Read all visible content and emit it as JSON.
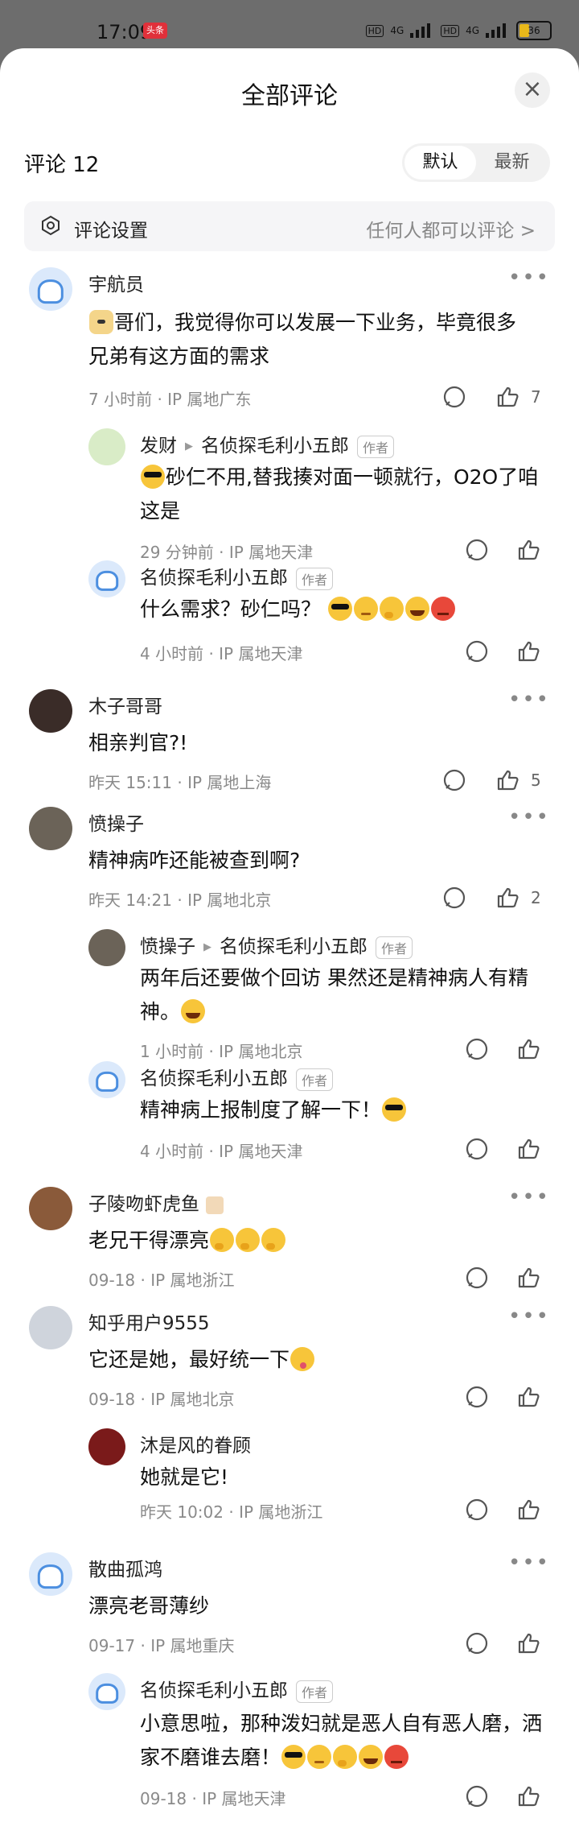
{
  "status_bar": {
    "time": "17:09",
    "app_badge": "头条",
    "network": "4G",
    "battery": "36",
    "battery_level": 0.36
  },
  "sheet": {
    "title": "全部评论",
    "close_icon": "close-icon",
    "count_label": "评论 12",
    "sort": {
      "default": "默认",
      "latest": "最新",
      "selected": "默认"
    },
    "settings": {
      "label": "评论设置",
      "value": "任何人都可以评论 >",
      "icon": "settings-icon"
    }
  },
  "comments": [
    {
      "name": "宇航员",
      "text_line1": "哥们，我觉得你可以发展一下业务，毕竟很多",
      "text_line2": "兄弟有这方面的需求",
      "meta": "7 小时前 · IP 属地广东",
      "likes": "7",
      "replies": [
        {
          "name": "发财",
          "target": "名侦探毛利小五郎",
          "tag": "作者",
          "text_line1": "砂仁不用,替我揍对面一顿就行，O2O了咱",
          "text_line2": "这是",
          "meta": "29 分钟前 · IP 属地天津"
        },
        {
          "name": "名侦探毛利小五郎",
          "tag": "作者",
          "text_line1": "什么需求？砂仁吗？",
          "meta": "4 小时前 · IP 属地天津"
        }
      ]
    },
    {
      "name": "木子哥哥",
      "text_line1": "相亲判官?!",
      "meta": "昨天 15:11 · IP 属地上海",
      "likes": "5"
    },
    {
      "name": "愤操子",
      "text_line1": "精神病咋还能被查到啊?",
      "meta": "昨天 14:21 · IP 属地北京",
      "likes": "2",
      "replies": [
        {
          "name": "愤操子",
          "target": "名侦探毛利小五郎",
          "tag": "作者",
          "text_line1": "两年后还要做个回访 果然还是精神病人有精",
          "text_line2": "神。",
          "meta": "1 小时前 · IP 属地北京"
        },
        {
          "name": "名侦探毛利小五郎",
          "tag": "作者",
          "text_line1": "精神病上报制度了解一下！",
          "meta": "4 小时前 · IP 属地天津"
        }
      ]
    },
    {
      "name": "子陵吻虾虎鱼",
      "text_line1": "老兄干得漂亮",
      "meta": "09-18 · IP 属地浙江"
    },
    {
      "name": "知乎用户9555",
      "text_line1": "它还是她，最好统一下",
      "meta": "09-18 · IP 属地北京",
      "replies": [
        {
          "name": "沐是风的眷顾",
          "text_line1": "她就是它!",
          "meta": "昨天 10:02 · IP 属地浙江"
        }
      ]
    },
    {
      "name": "散曲孤鸿",
      "text_line1": "漂亮老哥薄纱",
      "meta": "09-17 · IP 属地重庆",
      "replies": [
        {
          "name": "名侦探毛利小五郎",
          "tag": "作者",
          "text_line1": "小意思啦，那种泼妇就是恶人自有恶人磨，洒",
          "text_line2": "家不磨谁去磨！",
          "meta": "09-18 · IP 属地天津"
        }
      ]
    }
  ],
  "icons": {
    "more": "more-icon",
    "comment": "comment-icon",
    "like": "like-icon"
  }
}
